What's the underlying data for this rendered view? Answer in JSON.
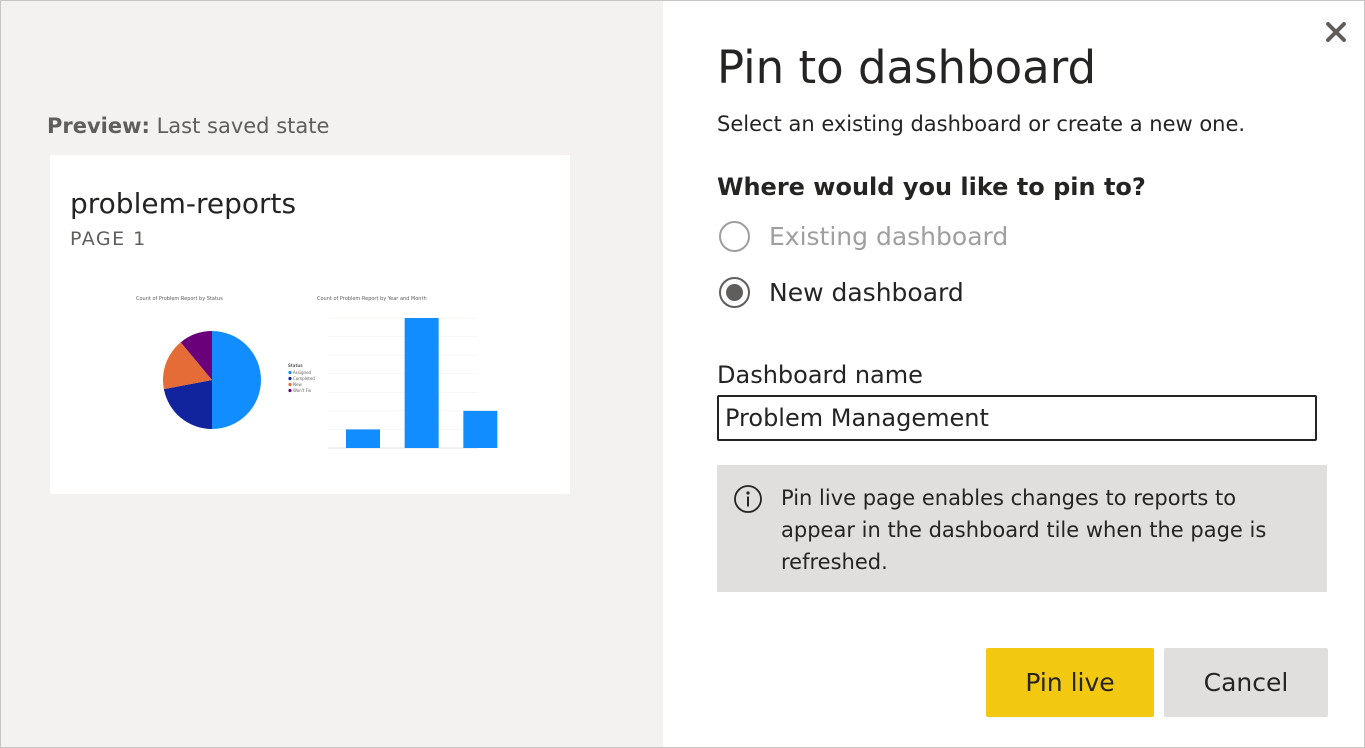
{
  "dialog": {
    "title": "Pin to dashboard",
    "subtitle": "Select an existing dashboard or create a new one.",
    "close_icon": "close-icon"
  },
  "preview": {
    "label": "Preview:",
    "state": "Last saved state",
    "report_title": "problem-reports",
    "page_label": "PAGE 1"
  },
  "pin_target": {
    "question": "Where would you like to pin to?",
    "options": [
      {
        "label": "Existing dashboard",
        "selected": false,
        "enabled": false
      },
      {
        "label": "New dashboard",
        "selected": true,
        "enabled": true
      }
    ]
  },
  "dashboard_name": {
    "label": "Dashboard name",
    "value": "Problem Management"
  },
  "info": {
    "icon": "info-icon",
    "text": "Pin live page enables changes to reports to appear in the dashboard tile when the page is refreshed."
  },
  "buttons": {
    "primary": "Pin live",
    "secondary": "Cancel"
  },
  "colors": {
    "primary_button": "#f2c811",
    "preview_background": "#f3f2f1",
    "info_background": "#e1dfdd",
    "chart_blue": "#118dff",
    "chart_navy": "#12239e",
    "chart_orange": "#e66c37",
    "chart_purple": "#6b007b"
  },
  "chart_data": [
    {
      "type": "pie",
      "title": "Count of Problem Report by Status",
      "legend_title": "Status",
      "categories": [
        "Assigned",
        "Completed",
        "New",
        "Won't Fix"
      ],
      "values": [
        50,
        22,
        17,
        11
      ],
      "colors": [
        "#118dff",
        "#12239e",
        "#e66c37",
        "#6b007b"
      ],
      "legend": "right"
    },
    {
      "type": "bar",
      "title": "Count of Problem Report by Year and Month",
      "categories": [
        "",
        "",
        ""
      ],
      "values": [
        1,
        7,
        2
      ],
      "ylim": [
        0,
        7
      ],
      "color": "#118dff"
    }
  ]
}
